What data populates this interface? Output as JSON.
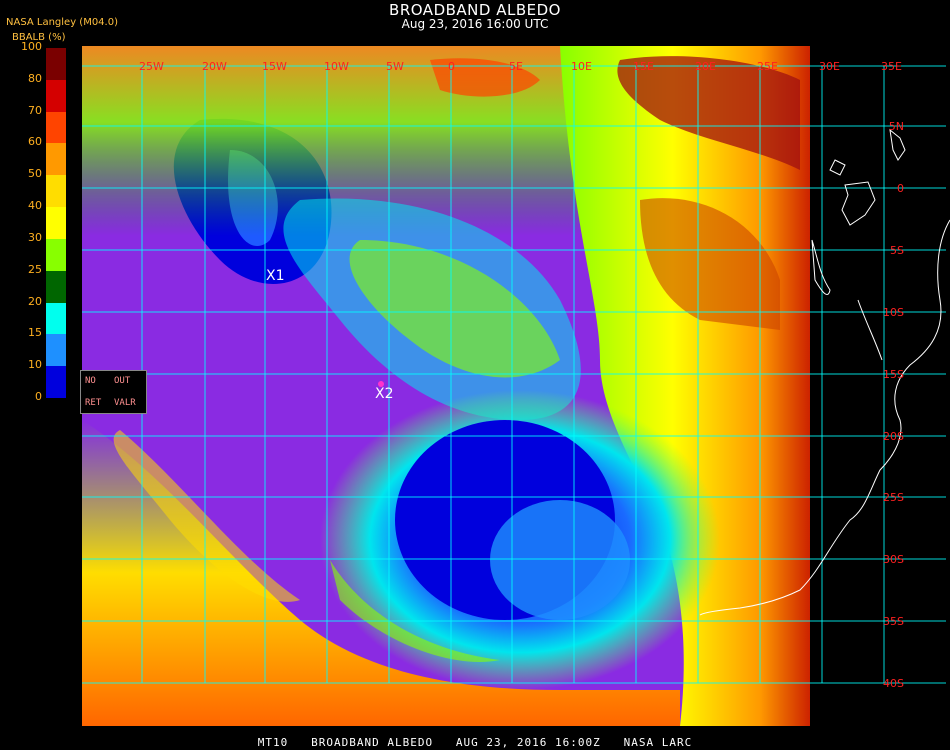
{
  "header": {
    "title": "BROADBAND ALBEDO",
    "datetime": "Aug 23, 2016 16:00 UTC",
    "source": "NASA Langley (M04.0)"
  },
  "colorbar": {
    "unit_label": "BBALB (%)",
    "ticks": [
      "100",
      "80",
      "70",
      "60",
      "50",
      "40",
      "30",
      "25",
      "20",
      "15",
      "10",
      "0"
    ],
    "colors": [
      "#7a0000",
      "#d40000",
      "#ff4400",
      "#ff9900",
      "#ffdd00",
      "#ffff00",
      "#88ff00",
      "#006600",
      "#00ffee",
      "#1e90ff",
      "#0000dd",
      "#8a2be2"
    ]
  },
  "nodata_box": {
    "top_left": "NO",
    "top_right": "OUT",
    "bottom_left": "RET",
    "bottom_right": "VALR"
  },
  "map": {
    "lon_labels": [
      "25W",
      "20W",
      "15W",
      "10W",
      "5W",
      "0",
      "5E",
      "10E",
      "15E",
      "20E",
      "25E",
      "30E",
      "35E"
    ],
    "lat_labels": [
      "5N",
      "0",
      "5S",
      "10S",
      "15S",
      "20S",
      "25S",
      "30S",
      "35S",
      "40S"
    ],
    "markers": [
      "X1",
      "X2"
    ],
    "grid_color": "#00ffff",
    "label_color": "#ff2020"
  },
  "footer": "MT10   BROADBAND ALBEDO   AUG 23, 2016 16:00Z   NASA LARC"
}
